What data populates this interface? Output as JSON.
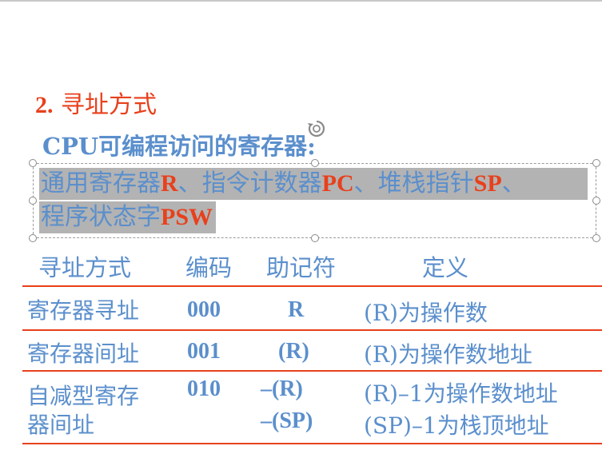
{
  "heading": {
    "number": "2.",
    "title": "寻址方式"
  },
  "subheading": "CPU可编程访问的寄存器:",
  "registers": {
    "line1": [
      {
        "text": "通用寄存器",
        "accent": false
      },
      {
        "text": "R",
        "accent": true
      },
      {
        "text": "、指令计数器",
        "accent": false
      },
      {
        "text": "PC",
        "accent": true
      },
      {
        "text": "、堆栈指针",
        "accent": false
      },
      {
        "text": "SP",
        "accent": true
      },
      {
        "text": "、",
        "accent": false
      }
    ],
    "line2": [
      {
        "text": "程序状态字",
        "accent": false
      },
      {
        "text": "PSW",
        "accent": true
      }
    ]
  },
  "table": {
    "headers": [
      "寻址方式",
      "编码",
      "助记符",
      "定义"
    ],
    "rows": [
      {
        "mode": [
          "寄存器寻址"
        ],
        "code": "000",
        "mnemonics": [
          "R"
        ],
        "definitions": [
          "(R)为操作数"
        ]
      },
      {
        "mode": [
          "寄存器间址"
        ],
        "code": "001",
        "mnemonics": [
          "(R)"
        ],
        "definitions": [
          "(R)为操作数地址"
        ]
      },
      {
        "mode": [
          "自减型寄存",
          "器间址"
        ],
        "code": "010",
        "mnemonics": [
          "–(R)",
          "–(SP)"
        ],
        "definitions": [
          "(R)–1为操作数地址",
          "(SP)–1为栈顶地址"
        ]
      }
    ]
  },
  "colors": {
    "accent": "#e8401c",
    "text": "#5b8fcc",
    "highlight": "#b3b3b3"
  },
  "icons": {
    "rotate": "rotate-handle-icon"
  }
}
